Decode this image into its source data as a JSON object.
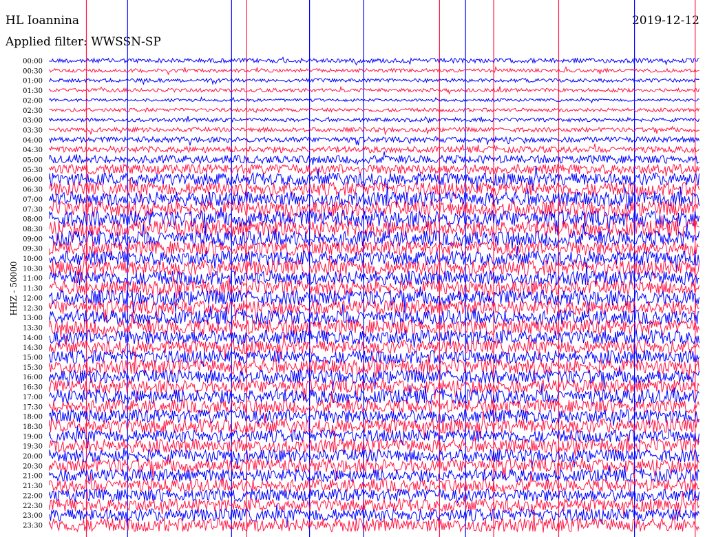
{
  "header": {
    "station": "HL Ioannina",
    "date": "2019-12-12",
    "filter": "Applied filter: WWSSN-SP"
  },
  "chart_data": {
    "type": "line",
    "title": "HL Ioannina",
    "date": "2019-12-12",
    "subtitle": "Applied filter: WWSSN-SP",
    "ylabel": "HHZ - 50000",
    "trace_times": [
      "00:00",
      "00:30",
      "01:00",
      "01:30",
      "02:00",
      "02:30",
      "03:00",
      "03:30",
      "04:00",
      "04:30",
      "05:00",
      "05:30",
      "06:00",
      "06:30",
      "07:00",
      "07:30",
      "08:00",
      "08:30",
      "09:00",
      "09:30",
      "10:00",
      "10:30",
      "11:00",
      "11:30",
      "12:00",
      "12:30",
      "13:00",
      "13:30",
      "14:00",
      "14:30",
      "15:00",
      "15:30",
      "16:00",
      "16:30",
      "17:00",
      "17:30",
      "18:00",
      "18:30",
      "19:00",
      "19:30",
      "20:00",
      "20:30",
      "21:00",
      "21:30",
      "22:00",
      "22:30",
      "23:00",
      "23:30"
    ],
    "colors": [
      "#0000ff",
      "#ff1744"
    ],
    "trace_noise_level": [
      0.25,
      0.2,
      0.2,
      0.2,
      0.15,
      0.2,
      0.2,
      0.25,
      0.3,
      0.35,
      0.45,
      0.55,
      0.7,
      0.75,
      0.8,
      0.85,
      0.9,
      0.9,
      0.85,
      0.8,
      0.8,
      0.85,
      0.8,
      0.8,
      0.85,
      0.8,
      0.8,
      0.85,
      0.8,
      0.75,
      0.75,
      0.8,
      0.75,
      0.75,
      0.8,
      0.75,
      0.75,
      0.8,
      0.7,
      0.75,
      0.7,
      0.75,
      0.7,
      0.7,
      0.7,
      0.7,
      0.7,
      0.75
    ],
    "vertical_spikes_x_minutes": [
      12,
      18,
      19.2,
      23.5,
      27,
      29.8,
      3.6,
      20.5,
      14.5,
      1.7,
      8.4,
      9.1
    ]
  }
}
